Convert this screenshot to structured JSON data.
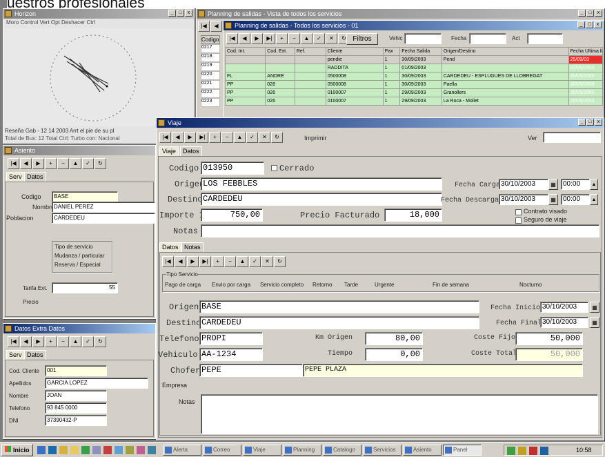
{
  "page_header": "uestros profesionales",
  "radar_window": {
    "title": "Horizon",
    "menu": "Moro   Control   Vert Opt   Deshacer   Ctrl",
    "status_line1": "Reseña Gab   -  12 14  2003 Arrt el pie de su pl",
    "status_line2": "Total de Bus: 12 Total Ctrl: Turbo con: Nacional"
  },
  "list_window": {
    "title": "Planning de salidas - Vista de todos los servicios",
    "inner_title": "Planning de salidas - Todos los servicios - 01",
    "filter_button": "Filtros",
    "filter_labels": [
      "Vehic",
      "Fecha",
      "Act"
    ],
    "codigo_header": "Codigo",
    "codigos": [
      "0217",
      "0218",
      "0219",
      "0220",
      "0221",
      "0222",
      "0223"
    ],
    "columns": [
      "Cod. Int.",
      "Cod. Ext.",
      "Ref.",
      "Cliente",
      "Pax",
      "Fecha Salida",
      "Origen/Destino",
      "Fecha Ultima Mod."
    ],
    "rows": [
      {
        "c1": "",
        "c2": "",
        "c3": "",
        "c4": "pendie",
        "c5": "1",
        "c6": "30/09/2003",
        "c7": "Pend",
        "c8": "25/09/03"
      },
      {
        "c1": "",
        "c2": "",
        "c3": "",
        "c4": "RADDITA",
        "c5": "1",
        "c6": "01/09/2003",
        "c7": "",
        "c8": "02/09/2003"
      },
      {
        "c1": "FL",
        "c2": "ANDRE",
        "c3": "",
        "c4": "0500008",
        "c5": "1",
        "c6": "30/09/2003",
        "c7": "CARDEDEU - ESPLUGUES DE LLOBREGAT",
        "c8": "30/09/2003"
      },
      {
        "c1": "PP",
        "c2": "028",
        "c3": "",
        "c4": "0500008",
        "c5": "1",
        "c6": "30/09/2003",
        "c7": "Paella",
        "c8": "30/09/2003"
      },
      {
        "c1": "PP",
        "c2": "026",
        "c3": "",
        "c4": "0100007",
        "c5": "1",
        "c6": "29/09/2003",
        "c7": "Granollers",
        "c8": "29/09/2003"
      },
      {
        "c1": "PP",
        "c2": "026",
        "c3": "",
        "c4": "0100007",
        "c5": "1",
        "c6": "29/09/2003",
        "c7": "La Roca - Mollet",
        "c8": "29/09/2003"
      }
    ]
  },
  "detail_window": {
    "title": "Asiento",
    "menu": "Datos  Extra  Datos",
    "tabs": [
      "Serv",
      "Datos"
    ],
    "codigo_label": "Codigo",
    "telefono_label": "Telefono",
    "telefono": "BASE",
    "nombre_label": "Nombre",
    "nombre": "DANIEL PEREZ",
    "poblacion_label": "Poblacion",
    "poblacion": "CARDEDEU",
    "fields": [
      {
        "label": "Cod. Cliente",
        "value": "001"
      },
      {
        "label": "Apellidos",
        "value": "GARCIA LOPEZ"
      },
      {
        "label": "Nombre",
        "value": "JOAN"
      },
      {
        "label": "Telefono",
        "value": "93 845 0000"
      },
      {
        "label": "DNI",
        "value": "37390432-P"
      }
    ],
    "options": [
      "Tipo de servicio",
      "Mudanza / particular",
      "Reserva / Especial"
    ],
    "tarifa_label": "Tarifa Ext.",
    "tarifa_value": "55",
    "precio_label": "Precio"
  },
  "viaje_window": {
    "title": "Viaje",
    "filter_button": "Imprimir",
    "search_label": "Ver",
    "tabs": [
      "Viaje",
      "Datos"
    ],
    "codigo_label": "Codigo",
    "codigo": "013950",
    "cerrado_label": "Cerrado",
    "origen_label": "Origen",
    "origen": "LOS FEBBLES",
    "destino_label": "Destino",
    "destino": "CARDEDEU",
    "importe_label": "Importe Int.",
    "importe": "750,00",
    "precio_label": "Precio Facturado",
    "precio": "18,000",
    "notas_label": "Notas",
    "fecha_carga_label": "Fecha Carga",
    "fecha_carga": "30/10/2003",
    "hora_carga": "00:00",
    "fecha_descarga_label": "Fecha Descarga",
    "fecha_descarga": "30/10/2003",
    "hora_descarga": "00:00",
    "check1": "Contrato visado",
    "check2": "Seguro de viaje",
    "sub_tabs": [
      "Datos",
      "Notas"
    ],
    "tipo_label": "Tipo Servicio",
    "radios": [
      "Pago de carga",
      "Envio por carga",
      "Servicio completo",
      "Retorno",
      "Tarde",
      "Urgente",
      "Fin de semana",
      "Nocturno"
    ],
    "s_origen_label": "Origen",
    "s_origen": "BASE",
    "s_destino_label": "Destino",
    "s_destino": "CARDEDEU",
    "telefono_label": "Telefono",
    "telefono": "PROPI",
    "km_label": "Km Origen",
    "km_value": "80,00",
    "coste_label": "Coste Fijo",
    "coste_value": "50,000",
    "vehiculo_label": "Vehiculo",
    "vehiculo": "AA-1234",
    "tiempo_label": "Tiempo",
    "tiempo": "0,00",
    "coste_total_label": "Coste Total",
    "coste_total": "50,000",
    "chofer_label": "Chofer",
    "chofer": "PEPE",
    "chofer_name": "PEPE PLAZA",
    "fecha_inicio_label": "Fecha Inicio",
    "fecha_inicio": "30/10/2003",
    "fecha_final_label": "Fecha Final",
    "fecha_final": "30/10/2003",
    "empresa_label": "Empresa"
  },
  "taskbar": {
    "start": "Inicio",
    "buttons": [
      "Alerta",
      "Correo",
      "Viaje",
      "Planning",
      "Catalogo",
      "Servicios",
      "Asiento",
      "Panel"
    ],
    "clock": "10:58"
  }
}
